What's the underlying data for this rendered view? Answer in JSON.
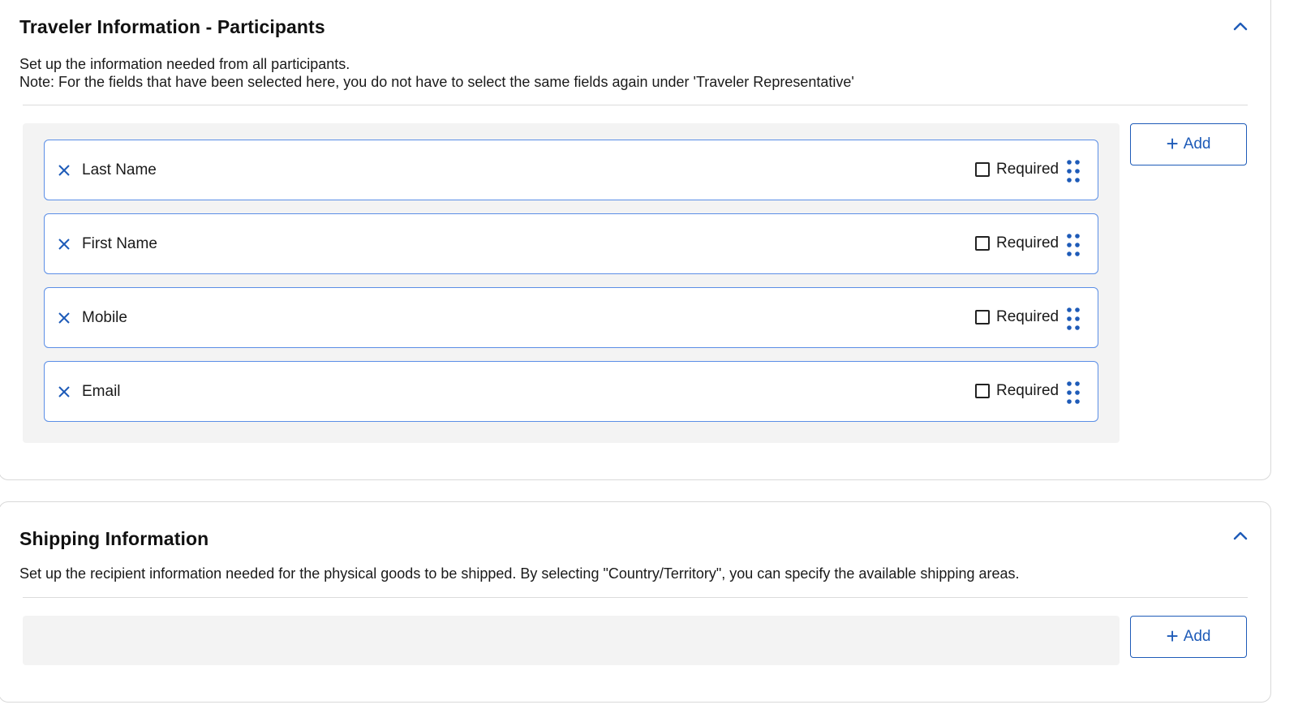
{
  "participants": {
    "title": "Traveler Information - Participants",
    "description_line1": "Set up the information needed from all participants.",
    "description_line2": "Note: For the fields that have been selected here, you do not have to select the same fields again under 'Traveler Representative'",
    "collapse_icon": "chevron-up-icon",
    "add_button": {
      "icon": "+",
      "label": "Add"
    },
    "fields": [
      {
        "label": "Last Name",
        "required_label": "Required",
        "required": false
      },
      {
        "label": "First Name",
        "required_label": "Required",
        "required": false
      },
      {
        "label": "Mobile",
        "required_label": "Required",
        "required": false
      },
      {
        "label": "Email",
        "required_label": "Required",
        "required": false
      }
    ]
  },
  "shipping": {
    "title": "Shipping Information",
    "description": "Set up the recipient information needed for the physical goods to be shipped. By selecting \"Country/Territory\", you can specify the available shipping areas.",
    "collapse_icon": "chevron-up-icon",
    "add_button": {
      "icon": "+",
      "label": "Add"
    },
    "fields": []
  },
  "colors": {
    "accent": "#1e5bb8",
    "field_border": "#5b8ee6",
    "field_area_bg": "#f3f3f3",
    "divider": "#dcdcdc"
  }
}
